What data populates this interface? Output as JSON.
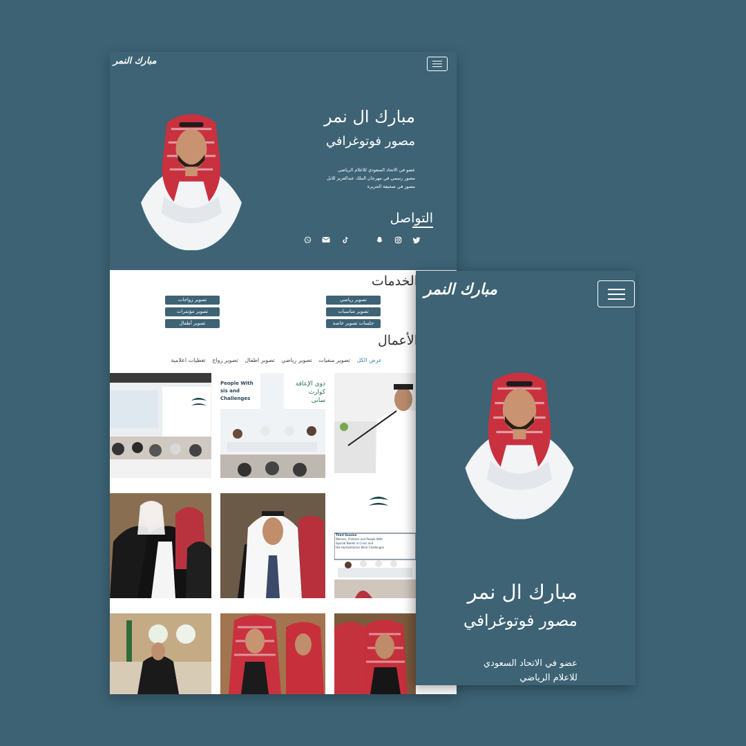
{
  "brand": {
    "logo_text": "مبارك النمر"
  },
  "hero": {
    "name": "مبارك ال نمر",
    "job": "مصور فوتوغرافي",
    "bio_lines": [
      "عضو في الاتحاد السعودي للاعلام الرياضي",
      "مصور رسمي في مهرجان الملك عبدالعزيز للابل",
      "مصور في صحيفة الجزيرة"
    ]
  },
  "contact": {
    "title": "التواصل",
    "icons": [
      "twitter-icon",
      "instagram-icon",
      "snapchat-icon",
      "tiktok-icon",
      "email-icon",
      "whatsapp-icon"
    ]
  },
  "services": {
    "title": "الخدمات",
    "items": [
      "تصوير رياضي",
      "تصوير مناسبات",
      "جلسات تصوير خاصة",
      "تصوير زواجات",
      "تصوير مؤتمرات",
      "تصوير أطفال"
    ]
  },
  "works": {
    "title": "الأعمال",
    "filters": [
      "عرض الكل",
      "تصوير منفيات",
      "تصوير رياضي",
      "تصوير اطفال",
      "تصوير زواج",
      "تغطيات اعلامية"
    ],
    "active_filter": "عرض الكل",
    "photo_texts": {
      "panel": [
        "People With",
        "sis and",
        "Challenges"
      ],
      "sign_ar": [
        "ذوي الإعاقة",
        "كوارث",
        "سانى"
      ],
      "session": [
        "Third Session",
        "Women, Children and People With",
        "Special Needs in Crisis and",
        "the Humanitarian Work Challenges"
      ]
    }
  },
  "mobile": {
    "name": "مبارك ال نمر",
    "job": "مصور فوتوغرافي",
    "bio_lines": [
      "عضو في الاتحاد السعودي",
      "للاعلام الرياضي"
    ]
  },
  "colors": {
    "background": "#3c6274",
    "hero": "#3d6375",
    "accent": "#3a82b7",
    "white": "#ffffff"
  }
}
